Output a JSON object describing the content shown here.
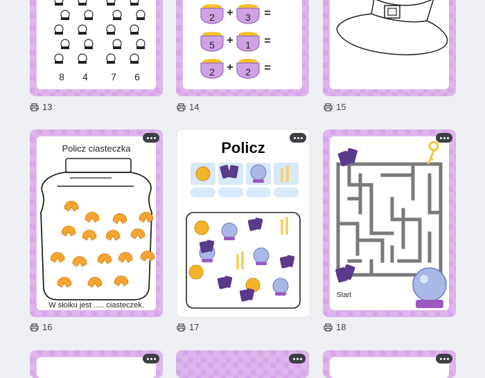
{
  "cards": [
    {
      "number": "13"
    },
    {
      "number": "14"
    },
    {
      "number": "15"
    },
    {
      "number": "16",
      "title": "Policz ciasteczka",
      "caption": "W słoiku jest ..... ciasteczek."
    },
    {
      "number": "17",
      "title": "Policz"
    },
    {
      "number": "18",
      "start_label": "Start"
    }
  ],
  "card13": {
    "counts": [
      "8",
      "4",
      "7",
      "6"
    ]
  },
  "card14": {
    "rows": [
      {
        "a": "2",
        "b": "3",
        "plus": "+",
        "eq": "="
      },
      {
        "a": "5",
        "b": "1",
        "plus": "+",
        "eq": "="
      },
      {
        "a": "2",
        "b": "2",
        "plus": "+",
        "eq": "="
      }
    ]
  },
  "icons": {
    "print": "printer-icon",
    "more": "more-options-icon"
  },
  "colors": {
    "purple": "#d6a6e8",
    "cookie": "#f7a531",
    "candle": "#f5d36a",
    "orb": "#a9b8e6",
    "card_border": "#7a5a9c"
  }
}
